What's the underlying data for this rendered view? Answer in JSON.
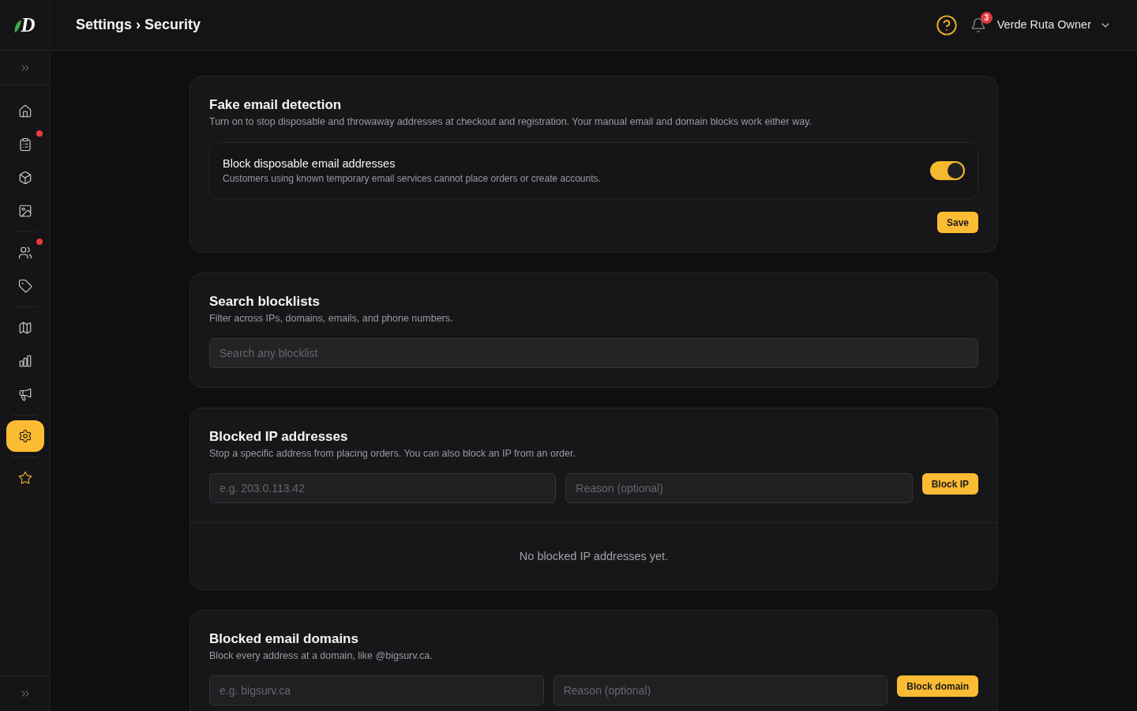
{
  "app": {
    "logo_text": "D"
  },
  "header": {
    "breadcrumb": "Settings › Security",
    "notification_count": "3",
    "user_name": "Verde Ruta Owner"
  },
  "sidebar": {
    "groups": [
      [
        {
          "selected": false,
          "alert": false
        },
        {
          "selected": false,
          "alert": true
        },
        {
          "selected": false,
          "alert": false
        },
        {
          "selected": false,
          "alert": false
        }
      ],
      [
        {
          "selected": false,
          "alert": true
        },
        {
          "selected": false,
          "alert": false
        }
      ],
      [
        {
          "selected": false,
          "alert": false
        },
        {
          "selected": false,
          "alert": false
        },
        {
          "selected": false,
          "alert": false
        }
      ],
      [
        {
          "selected": true,
          "alert": false
        }
      ],
      [
        {
          "selected": false,
          "alert": false
        }
      ]
    ]
  },
  "sections": [
    {
      "kind": "toggle",
      "title": "Fake email detection",
      "description": "Turn on to stop disposable and throwaway addresses at checkout and registration. Your manual email and domain blocks work either way.",
      "option": {
        "label": "Block disposable email addresses",
        "description": "Customers using known temporary email services cannot place orders or create accounts.",
        "on": true
      },
      "button": "Save"
    },
    {
      "kind": "search",
      "title": "Search blocklists",
      "description": "Filter across IPs, domains, emails, and phone numbers.",
      "search": {
        "placeholder": "Search any blocklist"
      }
    },
    {
      "kind": "blocklist",
      "title": "Blocked IP addresses",
      "description": "Stop a specific address from placing orders. You can also block an IP from an order.",
      "fields": [
        {
          "placeholder": "e.g. 203.0.113.42"
        },
        {
          "placeholder": "Reason (optional)"
        }
      ],
      "button": "Block IP",
      "empty_text": "No blocked IP addresses yet."
    },
    {
      "kind": "blocklist",
      "title": "Blocked email domains",
      "description": "Block every address at a domain, like @bigsurv.ca.",
      "fields": [
        {
          "placeholder": "e.g. bigsurv.ca"
        },
        {
          "placeholder": "Reason (optional)"
        }
      ],
      "button": "Block domain"
    }
  ]
}
